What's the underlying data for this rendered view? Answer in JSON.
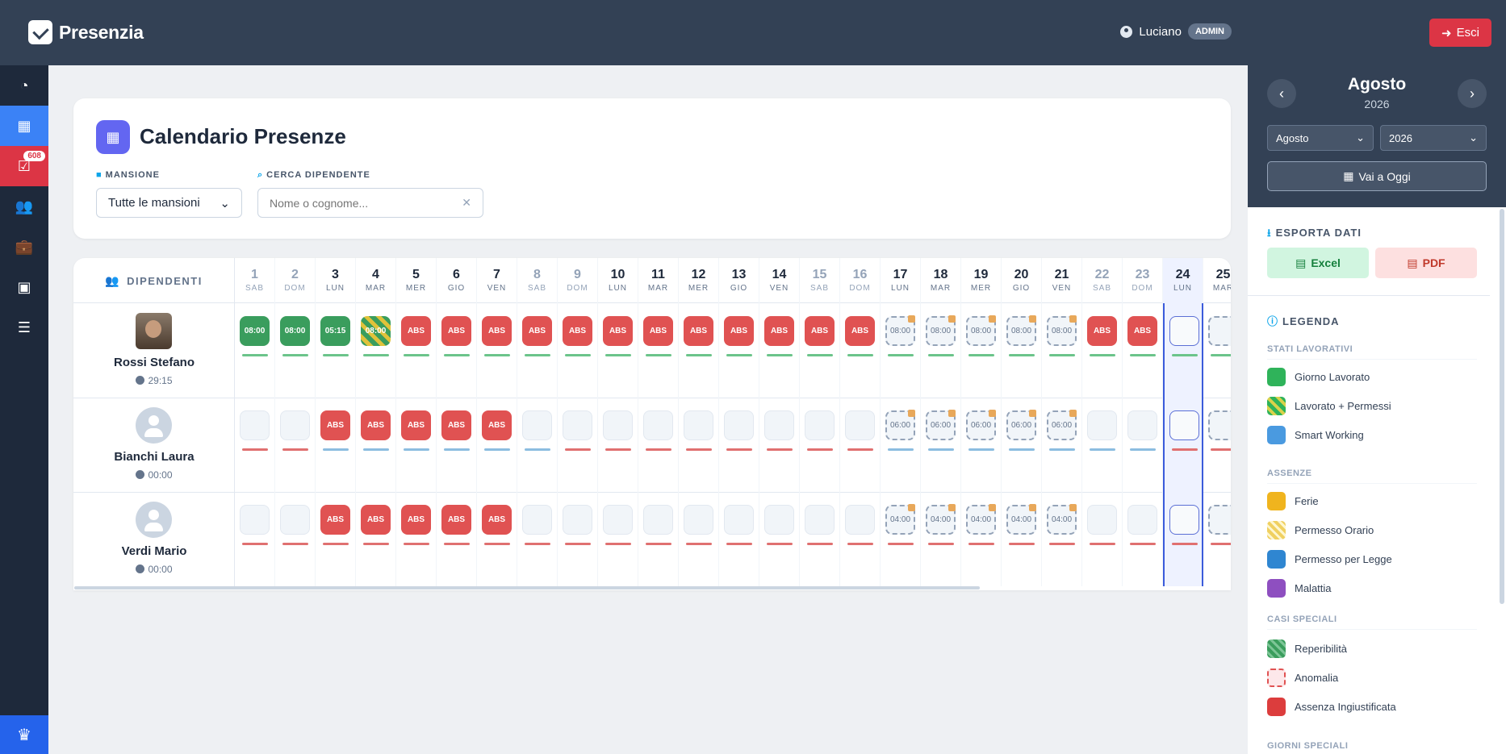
{
  "app": {
    "name": "Presenzia"
  },
  "header": {
    "user_name": "Luciano",
    "role_badge": "ADMIN",
    "logout_label": "Esci"
  },
  "sidebar": {
    "notifications_count": "608"
  },
  "page": {
    "title": "Calendario Presenze",
    "filters": {
      "role_label": "MANSIONE",
      "role_value": "Tutte le mansioni",
      "search_label": "CERCA DIPENDENTE",
      "search_placeholder": "Nome o cognome..."
    }
  },
  "calendar": {
    "employees_header": "DIPENDENTI",
    "days": [
      {
        "num": "1",
        "wd": "SAB"
      },
      {
        "num": "2",
        "wd": "DOM"
      },
      {
        "num": "3",
        "wd": "LUN"
      },
      {
        "num": "4",
        "wd": "MAR"
      },
      {
        "num": "5",
        "wd": "MER"
      },
      {
        "num": "6",
        "wd": "GIO"
      },
      {
        "num": "7",
        "wd": "VEN"
      },
      {
        "num": "8",
        "wd": "SAB"
      },
      {
        "num": "9",
        "wd": "DOM"
      },
      {
        "num": "10",
        "wd": "LUN"
      },
      {
        "num": "11",
        "wd": "MAR"
      },
      {
        "num": "12",
        "wd": "MER"
      },
      {
        "num": "13",
        "wd": "GIO"
      },
      {
        "num": "14",
        "wd": "VEN"
      },
      {
        "num": "15",
        "wd": "SAB"
      },
      {
        "num": "16",
        "wd": "DOM"
      },
      {
        "num": "17",
        "wd": "LUN"
      },
      {
        "num": "18",
        "wd": "MAR"
      },
      {
        "num": "19",
        "wd": "MER"
      },
      {
        "num": "20",
        "wd": "GIO"
      },
      {
        "num": "21",
        "wd": "VEN"
      },
      {
        "num": "22",
        "wd": "SAB"
      },
      {
        "num": "23",
        "wd": "DOM"
      },
      {
        "num": "24",
        "wd": "LUN"
      },
      {
        "num": "25",
        "wd": "MAR"
      }
    ],
    "employees": [
      {
        "name": "Rossi Stefano",
        "hours": "29:15",
        "avatar": "photo",
        "cells": [
          {
            "t": "work",
            "v": "08:00",
            "b": "g"
          },
          {
            "t": "work",
            "v": "08:00",
            "b": "g"
          },
          {
            "t": "work",
            "v": "05:15",
            "b": "g"
          },
          {
            "t": "perm",
            "v": "08:00",
            "b": "g"
          },
          {
            "t": "abs",
            "v": "ABS",
            "b": "g"
          },
          {
            "t": "abs",
            "v": "ABS",
            "b": "g"
          },
          {
            "t": "abs",
            "v": "ABS",
            "b": "g"
          },
          {
            "t": "abs",
            "v": "ABS",
            "b": "g"
          },
          {
            "t": "abs",
            "v": "ABS",
            "b": "g"
          },
          {
            "t": "abs",
            "v": "ABS",
            "b": "g"
          },
          {
            "t": "abs",
            "v": "ABS",
            "b": "g"
          },
          {
            "t": "abs",
            "v": "ABS",
            "b": "g"
          },
          {
            "t": "abs",
            "v": "ABS",
            "b": "g"
          },
          {
            "t": "abs",
            "v": "ABS",
            "b": "g"
          },
          {
            "t": "abs",
            "v": "ABS",
            "b": "g"
          },
          {
            "t": "abs",
            "v": "ABS",
            "b": "g"
          },
          {
            "t": "future",
            "v": "08:00",
            "b": "g"
          },
          {
            "t": "future",
            "v": "08:00",
            "b": "g"
          },
          {
            "t": "future",
            "v": "08:00",
            "b": "g"
          },
          {
            "t": "future",
            "v": "08:00",
            "b": "g"
          },
          {
            "t": "future",
            "v": "08:00",
            "b": "g"
          },
          {
            "t": "abs",
            "v": "ABS",
            "b": "g"
          },
          {
            "t": "abs",
            "v": "ABS",
            "b": "g"
          },
          {
            "t": "today",
            "v": "",
            "b": "g"
          },
          {
            "t": "future",
            "v": "",
            "b": "g"
          }
        ]
      },
      {
        "name": "Bianchi Laura",
        "hours": "00:00",
        "avatar": "placeholder",
        "cells": [
          {
            "t": "empty",
            "v": "",
            "b": "r"
          },
          {
            "t": "empty",
            "v": "",
            "b": "r"
          },
          {
            "t": "abs",
            "v": "ABS",
            "b": "b"
          },
          {
            "t": "abs",
            "v": "ABS",
            "b": "b"
          },
          {
            "t": "abs",
            "v": "ABS",
            "b": "b"
          },
          {
            "t": "abs",
            "v": "ABS",
            "b": "b"
          },
          {
            "t": "abs",
            "v": "ABS",
            "b": "b"
          },
          {
            "t": "empty",
            "v": "",
            "b": "b"
          },
          {
            "t": "empty",
            "v": "",
            "b": "r"
          },
          {
            "t": "empty",
            "v": "",
            "b": "r"
          },
          {
            "t": "empty",
            "v": "",
            "b": "r"
          },
          {
            "t": "empty",
            "v": "",
            "b": "r"
          },
          {
            "t": "empty",
            "v": "",
            "b": "r"
          },
          {
            "t": "empty",
            "v": "",
            "b": "r"
          },
          {
            "t": "empty",
            "v": "",
            "b": "r"
          },
          {
            "t": "empty",
            "v": "",
            "b": "r"
          },
          {
            "t": "future",
            "v": "06:00",
            "b": "b"
          },
          {
            "t": "future",
            "v": "06:00",
            "b": "b"
          },
          {
            "t": "future",
            "v": "06:00",
            "b": "b"
          },
          {
            "t": "future",
            "v": "06:00",
            "b": "b"
          },
          {
            "t": "future",
            "v": "06:00",
            "b": "b"
          },
          {
            "t": "empty",
            "v": "",
            "b": "b"
          },
          {
            "t": "empty",
            "v": "",
            "b": "b"
          },
          {
            "t": "today",
            "v": "",
            "b": "r"
          },
          {
            "t": "future",
            "v": "",
            "b": "r"
          }
        ]
      },
      {
        "name": "Verdi Mario",
        "hours": "00:00",
        "avatar": "placeholder",
        "cells": [
          {
            "t": "empty",
            "v": "",
            "b": "r"
          },
          {
            "t": "empty",
            "v": "",
            "b": "r"
          },
          {
            "t": "abs",
            "v": "ABS",
            "b": "r"
          },
          {
            "t": "abs",
            "v": "ABS",
            "b": "r"
          },
          {
            "t": "abs",
            "v": "ABS",
            "b": "r"
          },
          {
            "t": "abs",
            "v": "ABS",
            "b": "r"
          },
          {
            "t": "abs",
            "v": "ABS",
            "b": "r"
          },
          {
            "t": "empty",
            "v": "",
            "b": "r"
          },
          {
            "t": "empty",
            "v": "",
            "b": "r"
          },
          {
            "t": "empty",
            "v": "",
            "b": "r"
          },
          {
            "t": "empty",
            "v": "",
            "b": "r"
          },
          {
            "t": "empty",
            "v": "",
            "b": "r"
          },
          {
            "t": "empty",
            "v": "",
            "b": "r"
          },
          {
            "t": "empty",
            "v": "",
            "b": "r"
          },
          {
            "t": "empty",
            "v": "",
            "b": "r"
          },
          {
            "t": "empty",
            "v": "",
            "b": "r"
          },
          {
            "t": "future",
            "v": "04:00",
            "b": "r"
          },
          {
            "t": "future",
            "v": "04:00",
            "b": "r"
          },
          {
            "t": "future",
            "v": "04:00",
            "b": "r"
          },
          {
            "t": "future",
            "v": "04:00",
            "b": "r"
          },
          {
            "t": "future",
            "v": "04:00",
            "b": "r"
          },
          {
            "t": "empty",
            "v": "",
            "b": "r"
          },
          {
            "t": "empty",
            "v": "",
            "b": "r"
          },
          {
            "t": "today",
            "v": "",
            "b": "r"
          },
          {
            "t": "future",
            "v": "",
            "b": "r"
          }
        ]
      }
    ]
  },
  "right_panel": {
    "month": "Agosto",
    "year": "2026",
    "month_select": "Agosto",
    "year_select": "2026",
    "today_button": "Vai a Oggi",
    "export_title": "ESPORTA DATI",
    "excel_label": "Excel",
    "pdf_label": "PDF",
    "legend_title": "LEGENDA",
    "legend": [
      {
        "cat": "STATI LAVORATIVI",
        "items": [
          {
            "label": "Giorno Lavorato",
            "swatch": "#2fb35a"
          },
          {
            "label": "Lavorato + Permessi",
            "swatch": "stripe-green-yellow"
          },
          {
            "label": "Smart Working",
            "swatch": "#4a9ae0"
          }
        ]
      },
      {
        "cat": "ASSENZE",
        "items": [
          {
            "label": "Ferie",
            "swatch": "#f0b41e"
          },
          {
            "label": "Permesso Orario",
            "swatch": "stripe-yellow"
          },
          {
            "label": "Permesso per Legge",
            "swatch": "#2f86d1"
          },
          {
            "label": "Malattia",
            "swatch": "#8e4fc0"
          }
        ]
      },
      {
        "cat": "CASI SPECIALI",
        "items": [
          {
            "label": "Reperibilità",
            "swatch": "stripe-green"
          },
          {
            "label": "Anomalia",
            "swatch": "dashed-red"
          },
          {
            "label": "Assenza Ingiustificata",
            "swatch": "#dc3d3d"
          }
        ]
      },
      {
        "cat": "GIORNI SPECIALI",
        "items": []
      }
    ]
  }
}
